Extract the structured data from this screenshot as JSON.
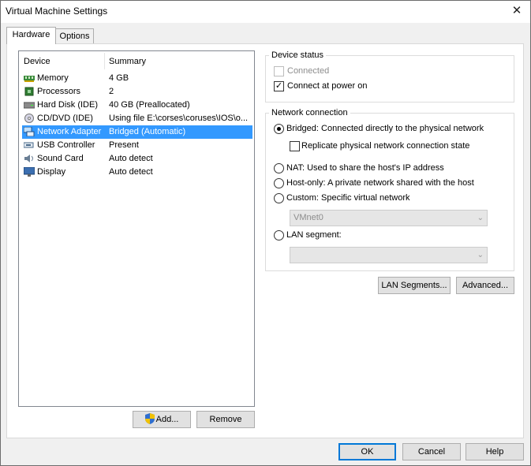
{
  "window": {
    "title": "Virtual Machine Settings",
    "close": "✕"
  },
  "tabs": [
    {
      "label": "Hardware",
      "active": true
    },
    {
      "label": "Options",
      "active": false
    }
  ],
  "device_list": {
    "headers": {
      "device": "Device",
      "summary": "Summary"
    },
    "rows": [
      {
        "name": "Memory",
        "summary": "4 GB",
        "icon": "memory-icon"
      },
      {
        "name": "Processors",
        "summary": "2",
        "icon": "processor-icon"
      },
      {
        "name": "Hard Disk (IDE)",
        "summary": "40 GB (Preallocated)",
        "icon": "hard-disk-icon"
      },
      {
        "name": "CD/DVD (IDE)",
        "summary": "Using file E:\\corses\\coruses\\IOS\\o...",
        "icon": "cd-dvd-icon"
      },
      {
        "name": "Network Adapter",
        "summary": "Bridged (Automatic)",
        "icon": "network-adapter-icon",
        "selected": true
      },
      {
        "name": "USB Controller",
        "summary": "Present",
        "icon": "usb-icon"
      },
      {
        "name": "Sound Card",
        "summary": "Auto detect",
        "icon": "sound-card-icon"
      },
      {
        "name": "Display",
        "summary": "Auto detect",
        "icon": "display-icon"
      }
    ]
  },
  "list_buttons": {
    "add": "Add...",
    "remove": "Remove"
  },
  "device_status": {
    "title": "Device status",
    "connected": {
      "label": "Connected",
      "checked": false,
      "enabled": false
    },
    "connect_at_power_on": {
      "label": "Connect at power on",
      "checked": true
    }
  },
  "network_connection": {
    "title": "Network connection",
    "bridged": {
      "label": "Bridged: Connected directly to the physical network",
      "selected": true
    },
    "replicate": {
      "label": "Replicate physical network connection state",
      "checked": false
    },
    "nat": {
      "label": "NAT: Used to share the host's IP address"
    },
    "host_only": {
      "label": "Host-only: A private network shared with the host"
    },
    "custom": {
      "label": "Custom: Specific virtual network",
      "value": "VMnet0"
    },
    "lan_segment": {
      "label": "LAN segment:",
      "value": ""
    }
  },
  "network_buttons": {
    "lan_segments": "LAN Segments...",
    "advanced": "Advanced..."
  },
  "dialog_buttons": {
    "ok": "OK",
    "cancel": "Cancel",
    "help": "Help"
  },
  "colors": {
    "selection": "#3399ff",
    "default_button_border": "#0078d7"
  }
}
